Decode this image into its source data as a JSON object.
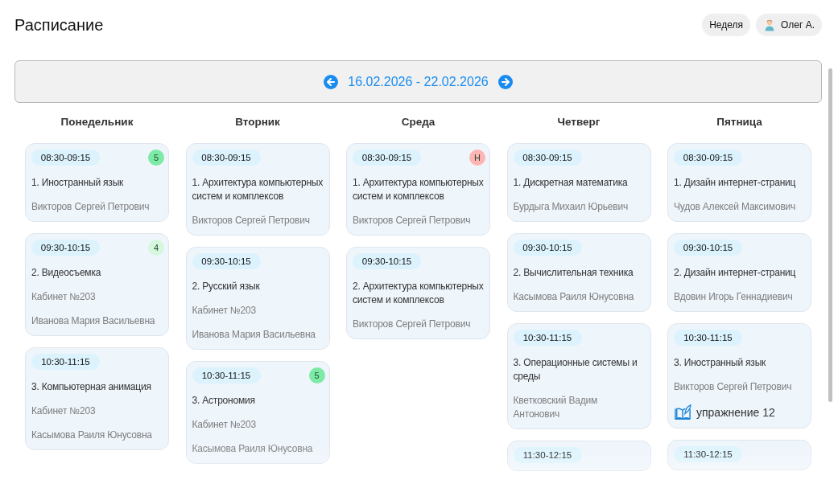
{
  "header": {
    "title": "Расписание",
    "view_button": "Неделя",
    "user": "Олег А."
  },
  "week": {
    "range": "16.02.2026 - 22.02.2026"
  },
  "days": [
    {
      "name": "Понедельник",
      "lessons": [
        {
          "time": "08:30-09:15",
          "title": "1. Иностранный язык",
          "teacher": "Викторов Сергей Петрович",
          "badge": {
            "text": "5",
            "color": "#7deaa6"
          }
        },
        {
          "time": "09:30-10:15",
          "title": "2. Видеосъемка",
          "room": "Кабинет №203",
          "teacher": "Иванова Мария Васильевна",
          "badge": {
            "text": "4",
            "color": "#d6f7dd"
          }
        },
        {
          "time": "10:30-11:15",
          "title": "3. Компьютерная анимация",
          "room": "Кабинет №203",
          "teacher": "Касымова Раиля Юнусовна"
        }
      ]
    },
    {
      "name": "Вторник",
      "lessons": [
        {
          "time": "08:30-09:15",
          "title": "1. Архитектура компьютерных систем и комплексов",
          "teacher": "Викторов Сергей Петрович"
        },
        {
          "time": "09:30-10:15",
          "title": "2. Русский язык",
          "room": "Кабинет №203",
          "teacher": "Иванова Мария Васильевна"
        },
        {
          "time": "10:30-11:15",
          "title": "3. Астрономия",
          "room": "Кабинет №203",
          "teacher": "Касымова Раиля Юнусовна",
          "badge": {
            "text": "5",
            "color": "#7deaa6"
          }
        }
      ]
    },
    {
      "name": "Среда",
      "lessons": [
        {
          "time": "08:30-09:15",
          "title": "1. Архитектура компьютерных систем и комплексов",
          "teacher": "Викторов Сергей Петрович",
          "badge": {
            "text": "Н",
            "color": "#ffb4b4"
          }
        },
        {
          "time": "09:30-10:15",
          "title": "2. Архитектура компьютерных систем и комплексов",
          "teacher": "Викторов Сергей Петрович"
        }
      ]
    },
    {
      "name": "Четверг",
      "lessons": [
        {
          "time": "08:30-09:15",
          "title": "1. Дискретная математика",
          "teacher": "Бурдыга Михаил Юрьевич"
        },
        {
          "time": "09:30-10:15",
          "title": "2. Вычислительная техника",
          "teacher": "Касымова Раиля Юнусовна"
        },
        {
          "time": "10:30-11:15",
          "title": "3. Операционные системы и среды",
          "teacher": "Кветковский Вадим Антонович"
        },
        {
          "time": "11:30-12:15"
        }
      ]
    },
    {
      "name": "Пятница",
      "lessons": [
        {
          "time": "08:30-09:15",
          "title": "1. Дизайн интернет-страниц",
          "teacher": "Чудов Алексей Максимович"
        },
        {
          "time": "09:30-10:15",
          "title": "2. Дизайн интернет-страниц",
          "teacher": "Вдовин Игорь Геннадиевич"
        },
        {
          "time": "10:30-11:15",
          "title": "3. Иностранный язык",
          "teacher": "Викторов Сергей Петрович",
          "homework": "упражнение 12"
        },
        {
          "time": "11:30-12:15"
        }
      ]
    }
  ]
}
